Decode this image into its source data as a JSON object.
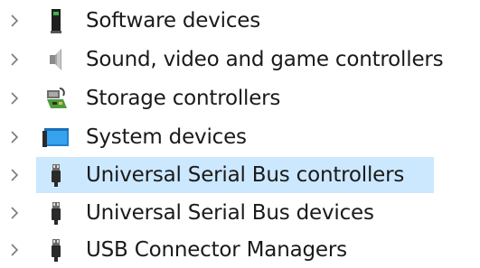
{
  "colors": {
    "selection": "#cce8ff",
    "text": "#1a1a1a",
    "chevron": "#7a7a7a"
  },
  "tree": {
    "items": [
      {
        "label": "Software devices",
        "icon": "software-device-icon",
        "selected": false
      },
      {
        "label": "Sound, video and game controllers",
        "icon": "speaker-icon",
        "selected": false
      },
      {
        "label": "Storage controllers",
        "icon": "storage-controller-icon",
        "selected": false
      },
      {
        "label": "System devices",
        "icon": "system-devices-icon",
        "selected": false
      },
      {
        "label": "Universal Serial Bus controllers",
        "icon": "usb-plug-icon",
        "selected": true
      },
      {
        "label": "Universal Serial Bus devices",
        "icon": "usb-plug-icon",
        "selected": false
      },
      {
        "label": "USB Connector Managers",
        "icon": "usb-plug-icon",
        "selected": false
      }
    ]
  }
}
